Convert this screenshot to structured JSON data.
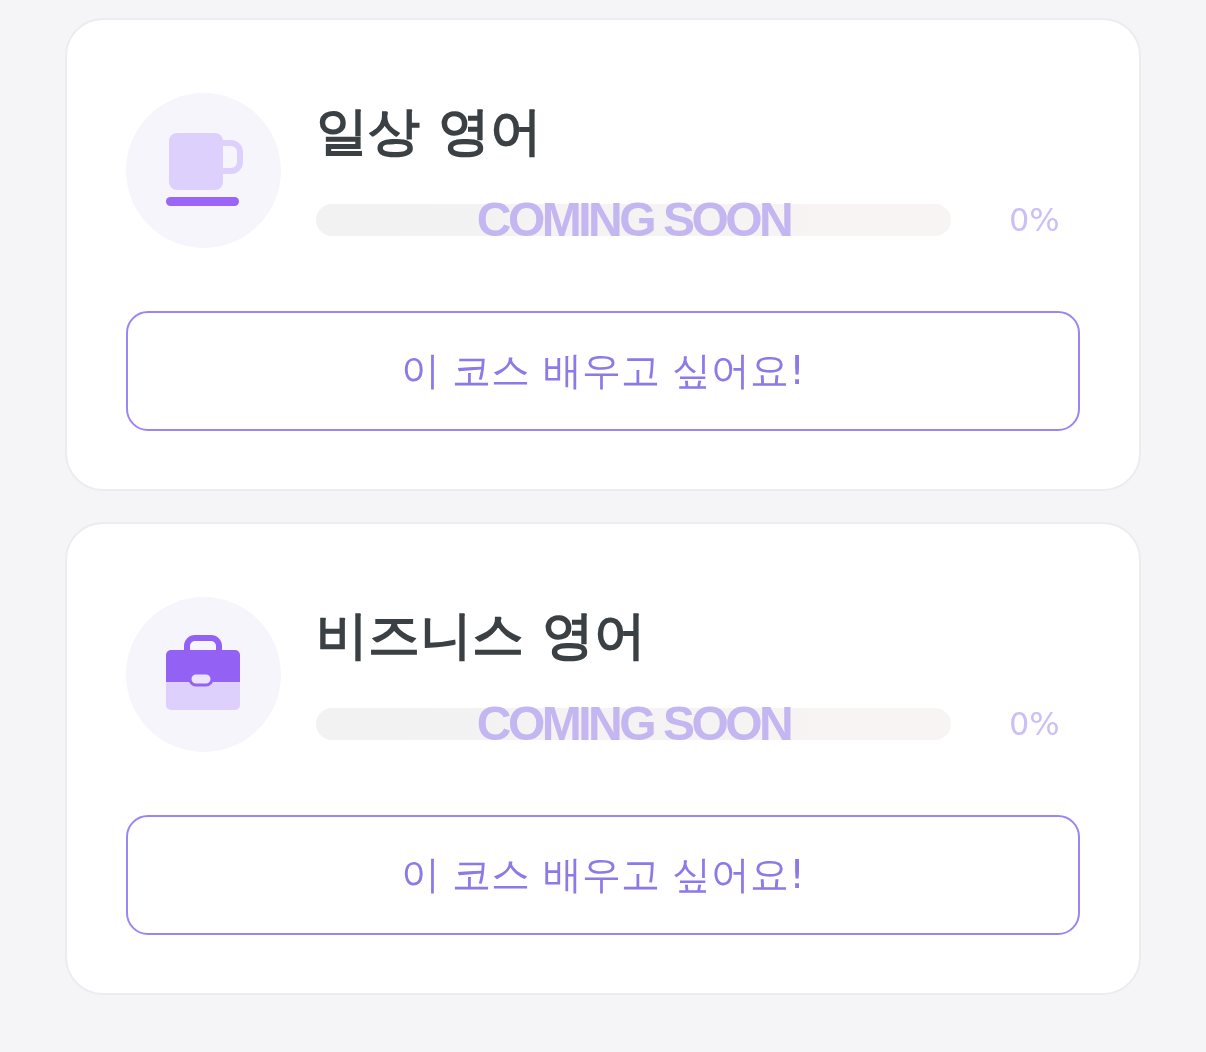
{
  "courses": [
    {
      "kind": "cup",
      "title": "일상 영어",
      "progress": {
        "level": 0,
        "status_label": "COMING SOON",
        "reading": "0%"
      },
      "button": "이 코스 배우고 싶어요!"
    },
    {
      "kind": "briefcase",
      "title": "비즈니스 영어",
      "progress": {
        "level": 0,
        "status_label": "COMING SOON",
        "reading": "0%"
      },
      "button": "이 코스 배우고 싶어요!"
    }
  ]
}
